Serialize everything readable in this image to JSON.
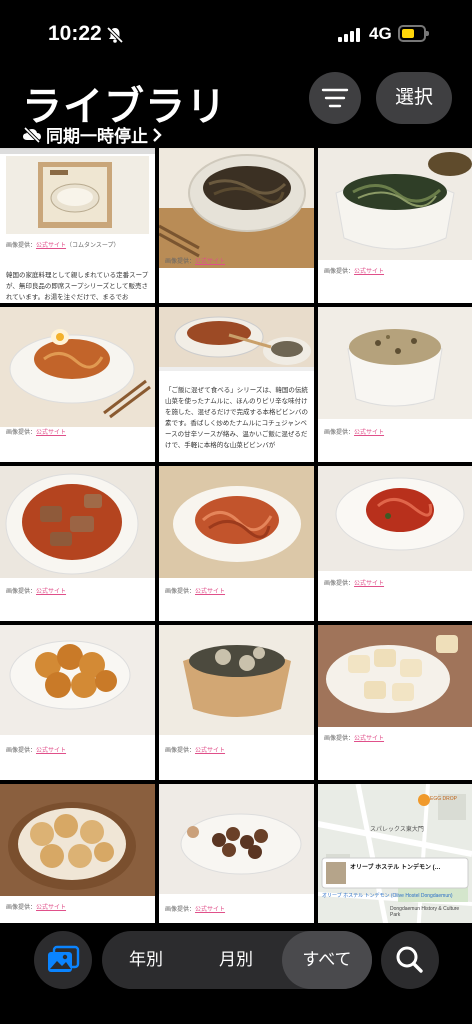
{
  "status": {
    "time": "10:22",
    "network": "4G"
  },
  "header": {
    "title": "ライブラリ",
    "sync": "同期一時停止",
    "select_label": "選択"
  },
  "photos": {
    "credit_prefix": "画像提供：",
    "credit_link": "公式サイト",
    "first_caption": "（コムタンスープ）",
    "article1_text": "韓国の家庭料理として親しまれている定番スープが、無印良品の即席スープシリーズとして販売されています。お湯を注ぐだけで、まるでお",
    "article2_text": "「ご飯に混ぜて食べる」シリーズは、韓国の伝統山菜を使ったナムルに、ほんのりピリ辛な味付けを施した、混ぜるだけで完成する本格ビビンバの素です。香ばしく炒めたナムルにコチュジャンベースの甘辛ソースが絡み、温かいご飯に混ぜるだけで、手軽に本格的な山菜ビビンバが",
    "map_tile": {
      "hotel": "オリーブ ホステル トンデモン (…",
      "district": "スパレックス東大門",
      "area": "Dongdaemun History & Culture Park",
      "egg": "EGG DROP",
      "caption": "オリーブ ホステル トンデモン (Olive Hostel Dongdaemun)"
    }
  },
  "bottom_nav": {
    "years": "年別",
    "months": "月別",
    "all": "すべて",
    "active": "all"
  },
  "colors": {
    "accent": "#0a84ff",
    "link_pink": "#e0508a",
    "battery": "#ffd60a"
  },
  "icons": [
    "bell-slash-icon",
    "signal-icon",
    "battery-icon",
    "cloud-slash-icon",
    "chevron-right-icon",
    "filter-icon",
    "photo-library-icon",
    "search-icon"
  ]
}
